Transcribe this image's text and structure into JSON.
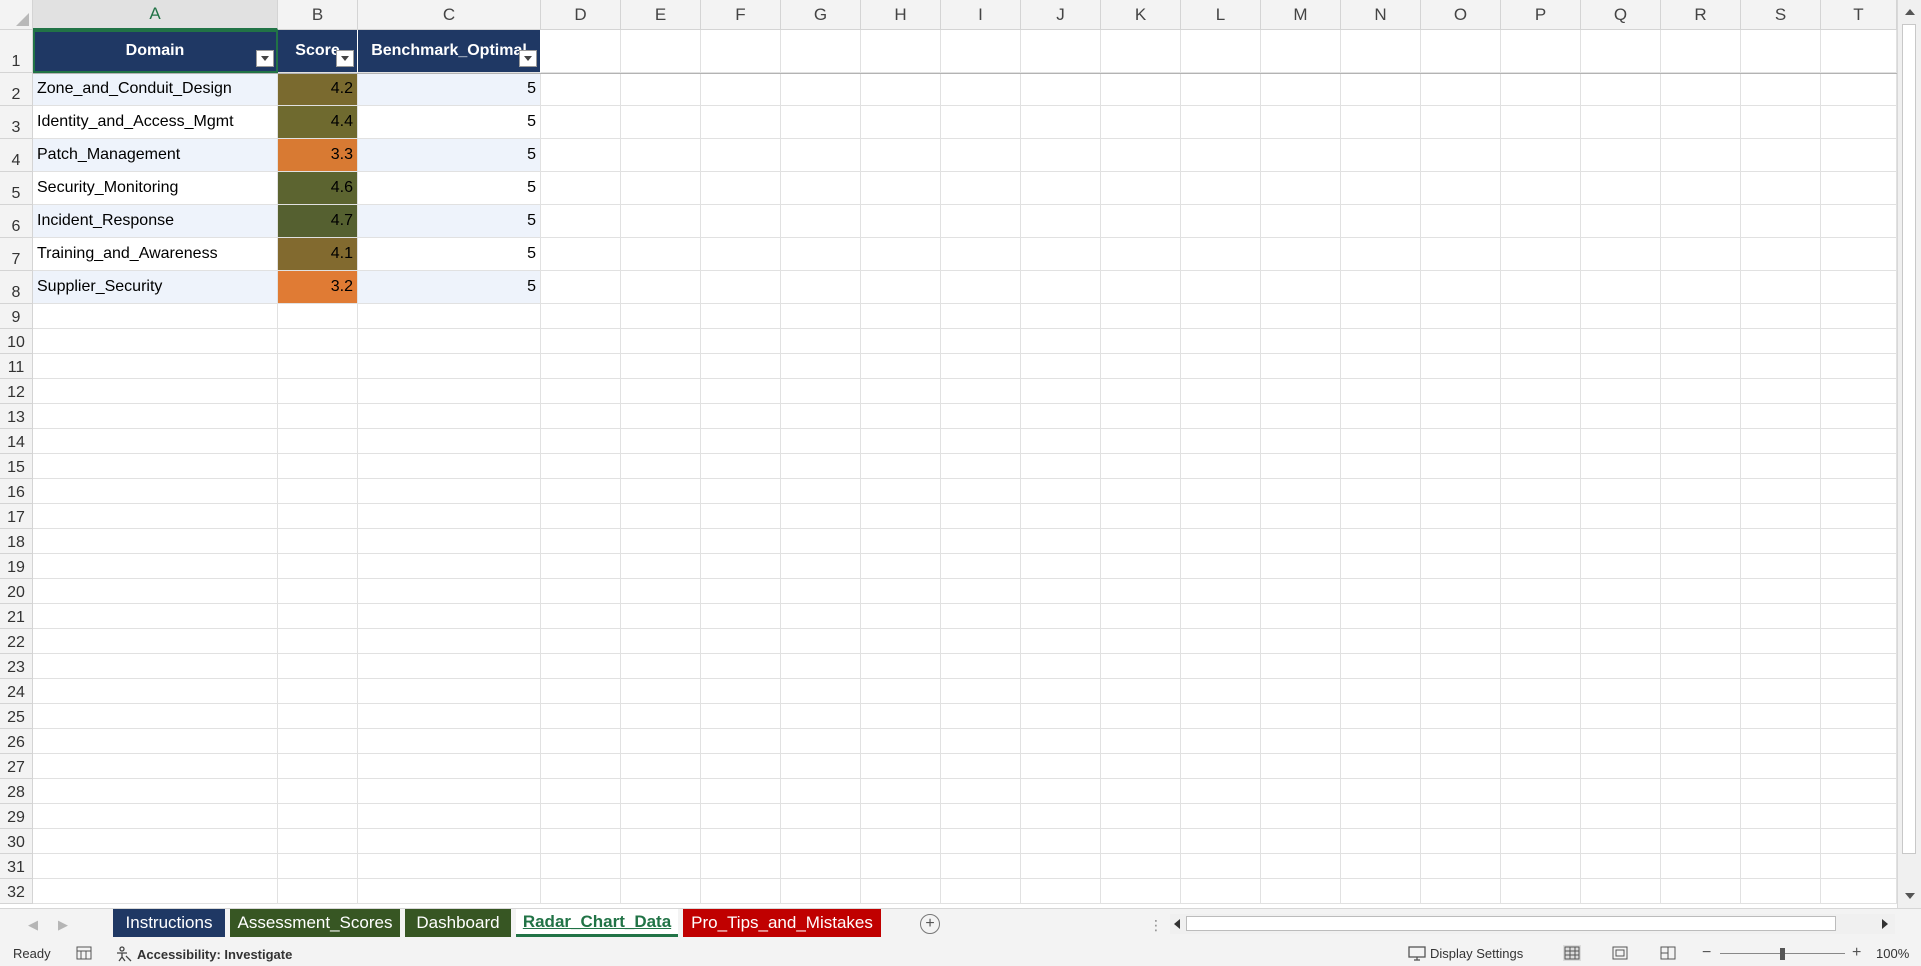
{
  "columns": [
    {
      "letter": "A",
      "width": 245
    },
    {
      "letter": "B",
      "width": 80
    },
    {
      "letter": "C",
      "width": 183
    },
    {
      "letter": "D",
      "width": 80
    },
    {
      "letter": "E",
      "width": 80
    },
    {
      "letter": "F",
      "width": 80
    },
    {
      "letter": "G",
      "width": 80
    },
    {
      "letter": "H",
      "width": 80
    },
    {
      "letter": "I",
      "width": 80
    },
    {
      "letter": "J",
      "width": 80
    },
    {
      "letter": "K",
      "width": 80
    },
    {
      "letter": "L",
      "width": 80
    },
    {
      "letter": "M",
      "width": 80
    },
    {
      "letter": "N",
      "width": 80
    },
    {
      "letter": "O",
      "width": 80
    },
    {
      "letter": "P",
      "width": 80
    },
    {
      "letter": "Q",
      "width": 80
    },
    {
      "letter": "R",
      "width": 80
    },
    {
      "letter": "S",
      "width": 80
    },
    {
      "letter": "T",
      "width": 80
    }
  ],
  "header": [
    "Domain",
    "Score",
    "Benchmark_Optimal"
  ],
  "rows": [
    {
      "domain": "Zone_and_Conduit_Design",
      "score": "4.2",
      "benchmark": "5",
      "score_color": "#7a6a2f"
    },
    {
      "domain": "Identity_and_Access_Mgmt",
      "score": "4.4",
      "benchmark": "5",
      "score_color": "#6f6a2f"
    },
    {
      "domain": "Patch_Management",
      "score": "3.3",
      "benchmark": "5",
      "score_color": "#d87a33"
    },
    {
      "domain": "Security_Monitoring",
      "score": "4.6",
      "benchmark": "5",
      "score_color": "#5c6430"
    },
    {
      "domain": "Incident_Response",
      "score": "4.7",
      "benchmark": "5",
      "score_color": "#556030"
    },
    {
      "domain": "Training_and_Awareness",
      "score": "4.1",
      "benchmark": "5",
      "score_color": "#826a2f"
    },
    {
      "domain": "Supplier_Security",
      "score": "3.2",
      "benchmark": "5",
      "score_color": "#e07b34"
    }
  ],
  "row_numbers": [
    "1",
    "2",
    "3",
    "4",
    "5",
    "6",
    "7",
    "8",
    "9",
    "10",
    "11",
    "12",
    "13",
    "14",
    "15",
    "16",
    "17",
    "18",
    "19",
    "20",
    "21",
    "22",
    "23",
    "24",
    "25",
    "26",
    "27",
    "28",
    "29",
    "30",
    "31",
    "32"
  ],
  "colors": {
    "header_bg": "#1f3864",
    "band_bg": "#eef3fb",
    "excel_green": "#217346"
  },
  "tabs": [
    {
      "label": "Instructions",
      "color": "#1f3864",
      "active": false
    },
    {
      "label": "Assessment_Scores",
      "color": "#375623",
      "active": false
    },
    {
      "label": "Dashboard",
      "color": "#375623",
      "active": false
    },
    {
      "label": "Radar_Chart_Data",
      "color": "#ffffff",
      "active": true
    },
    {
      "label": "Pro_Tips_and_Mistakes",
      "color": "#c00000",
      "active": false
    }
  ],
  "status": {
    "ready": "Ready",
    "accessibility": "Accessibility: Investigate",
    "display_settings": "Display Settings",
    "zoom": "100%"
  }
}
